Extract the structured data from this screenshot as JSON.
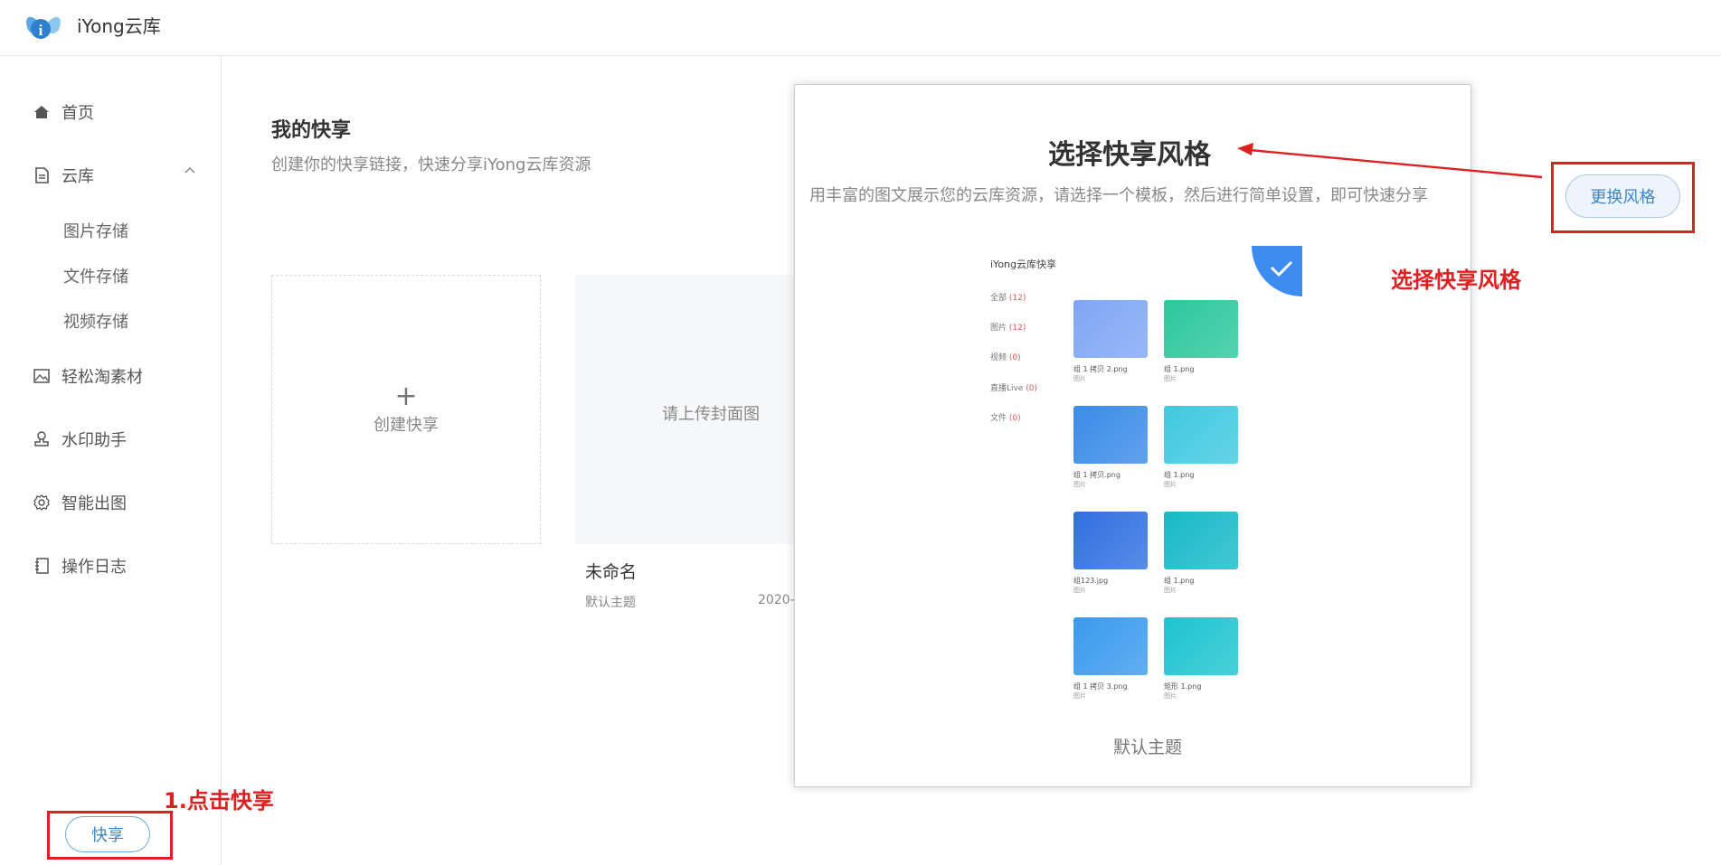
{
  "header": {
    "app_title": "iYong云库",
    "logo_icon": "butterfly-i-logo"
  },
  "sidebar": {
    "items": [
      {
        "label": "首页",
        "icon": "home-icon"
      },
      {
        "label": "云库",
        "icon": "document-icon",
        "expanded": true,
        "children": [
          {
            "label": "图片存储"
          },
          {
            "label": "文件存储"
          },
          {
            "label": "视频存储"
          }
        ]
      },
      {
        "label": "轻松淘素材",
        "icon": "image-icon"
      },
      {
        "label": "水印助手",
        "icon": "stamp-icon"
      },
      {
        "label": "智能出图",
        "icon": "gear-icon"
      },
      {
        "label": "操作日志",
        "icon": "notebook-icon"
      }
    ],
    "share_button": "快享"
  },
  "main": {
    "title": "我的快享",
    "subtitle": "创建你的快享链接，快速分享iYong云库资源",
    "create_card": {
      "plus": "+",
      "label": "创建快享"
    },
    "share_card": {
      "cover_hint": "请上传封面图",
      "name": "未命名",
      "theme": "默认主题",
      "date": "2020-"
    }
  },
  "modal": {
    "title": "选择快享风格",
    "description": "用丰富的图文展示您的云库资源，请选择一个模板，然后进行简单设置，即可快速分享",
    "theme_name": "默认主题",
    "preview": {
      "title": "iYong云库快享",
      "categories": [
        {
          "label": "全部",
          "count": "(12)"
        },
        {
          "label": "图片",
          "count": "(12)"
        },
        {
          "label": "视频",
          "count": "(0)"
        },
        {
          "label": "直播Live",
          "count": "(0)"
        },
        {
          "label": "文件",
          "count": "(0)"
        }
      ],
      "thumbnails": [
        {
          "name": "组 1 拷贝 2.png",
          "type": "图片",
          "color": "#7fa6f5"
        },
        {
          "name": "组 1.png",
          "type": "图片",
          "color": "#2cc89a"
        },
        {
          "name": "组 1 拷贝.png",
          "type": "图片",
          "color": "#3a8be8"
        },
        {
          "name": "组 1.png",
          "type": "图片",
          "color": "#3fc9e0"
        },
        {
          "name": "组123.jpg",
          "type": "图片",
          "color": "#2f6fe0"
        },
        {
          "name": "组 1.png",
          "type": "图片",
          "color": "#17b9c8"
        },
        {
          "name": "组 1 拷贝 3.png",
          "type": "图片",
          "color": "#3a9aee"
        },
        {
          "name": "矩形 1.png",
          "type": "图片",
          "color": "#1cc4cf"
        }
      ]
    }
  },
  "change_style_button": "更换风格",
  "annotations": {
    "step1": "1.点击快享",
    "choose_style": "选择快享风格"
  },
  "colors": {
    "accent": "#3e86c8",
    "annotation": "#e02020",
    "check": "#3d8df0"
  }
}
